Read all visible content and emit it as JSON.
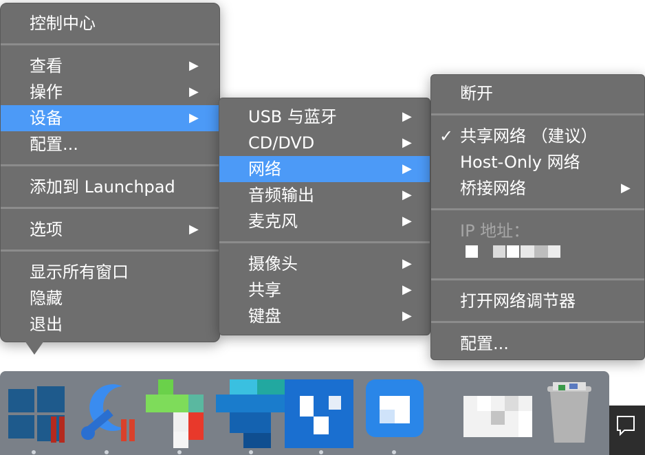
{
  "main_menu": {
    "title": "控制中心",
    "items": [
      {
        "label": "查看",
        "has_submenu": true
      },
      {
        "label": "操作",
        "has_submenu": true
      },
      {
        "label": "设备",
        "has_submenu": true,
        "highlighted": true
      },
      {
        "label": "配置...",
        "has_submenu": false
      },
      {
        "label": "添加到 Launchpad",
        "has_submenu": false
      },
      {
        "label": "选项",
        "has_submenu": true
      },
      {
        "label": "显示所有窗口",
        "has_submenu": false
      },
      {
        "label": "隐藏",
        "has_submenu": false
      },
      {
        "label": "退出",
        "has_submenu": false
      }
    ]
  },
  "device_menu": {
    "items": [
      {
        "label": "USB 与蓝牙",
        "has_submenu": true
      },
      {
        "label": "CD/DVD",
        "has_submenu": true
      },
      {
        "label": "网络",
        "has_submenu": true,
        "highlighted": true
      },
      {
        "label": "音频输出",
        "has_submenu": true
      },
      {
        "label": "麦克风",
        "has_submenu": true
      },
      {
        "label": "摄像头",
        "has_submenu": true
      },
      {
        "label": "共享",
        "has_submenu": true
      },
      {
        "label": "键盘",
        "has_submenu": true
      }
    ]
  },
  "network_menu": {
    "disconnect": "断开",
    "shared": {
      "label": "共享网络 （建议）",
      "checked": true
    },
    "host_only": "Host-Only 网络",
    "bridged": "桥接网络",
    "ip_label": "IP 地址：",
    "open_adjuster": "打开网络调节器",
    "configure": "配置..."
  },
  "glyphs": {
    "arrow": "▶",
    "check": "✓"
  },
  "colors": {
    "menu_bg": "#6e6e6e",
    "highlight": "#4c9af7",
    "dock_bg": "#7a8088"
  },
  "dock": {
    "icons": [
      "windows-app-icon",
      "repair-tool-icon",
      "pixelated-app-icon-1",
      "pixelated-app-icon-2",
      "pixelated-app-icon-3",
      "pixelated-app-icon-4",
      "pixelated-app-icon-5",
      "trash-icon"
    ]
  }
}
